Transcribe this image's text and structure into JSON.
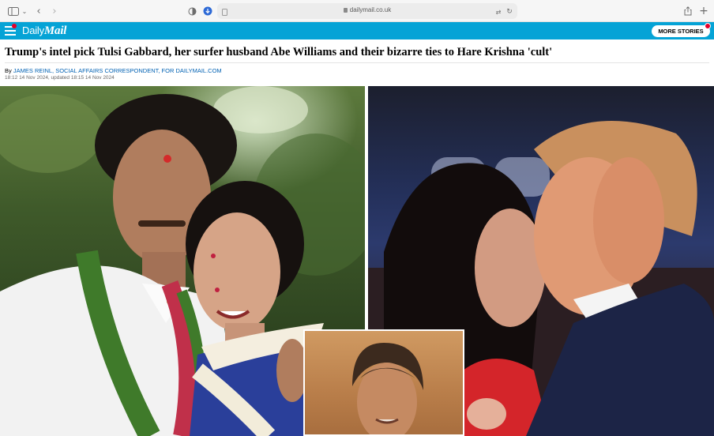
{
  "browser": {
    "url": "dailymail.co.uk"
  },
  "site": {
    "logo_daily": "Daily",
    "logo_mail": "Mail",
    "more_stories_label": "MORE STORIES"
  },
  "article": {
    "headline": "Trump's intel pick Tulsi Gabbard, her surfer husband Abe Williams and their bizarre ties to Hare Krishna 'cult'",
    "byline_prefix": "By",
    "author": "JAMES REINL, SOCIAL AFFAIRS CORRESPONDENT, FOR DAILYMAIL.COM",
    "dates": "18:12 14 Nov 2024, updated 18:15 14 Nov 2024"
  },
  "colors": {
    "brand": "#05a3d6",
    "notification": "#e4002b",
    "link": "#0061b3"
  }
}
